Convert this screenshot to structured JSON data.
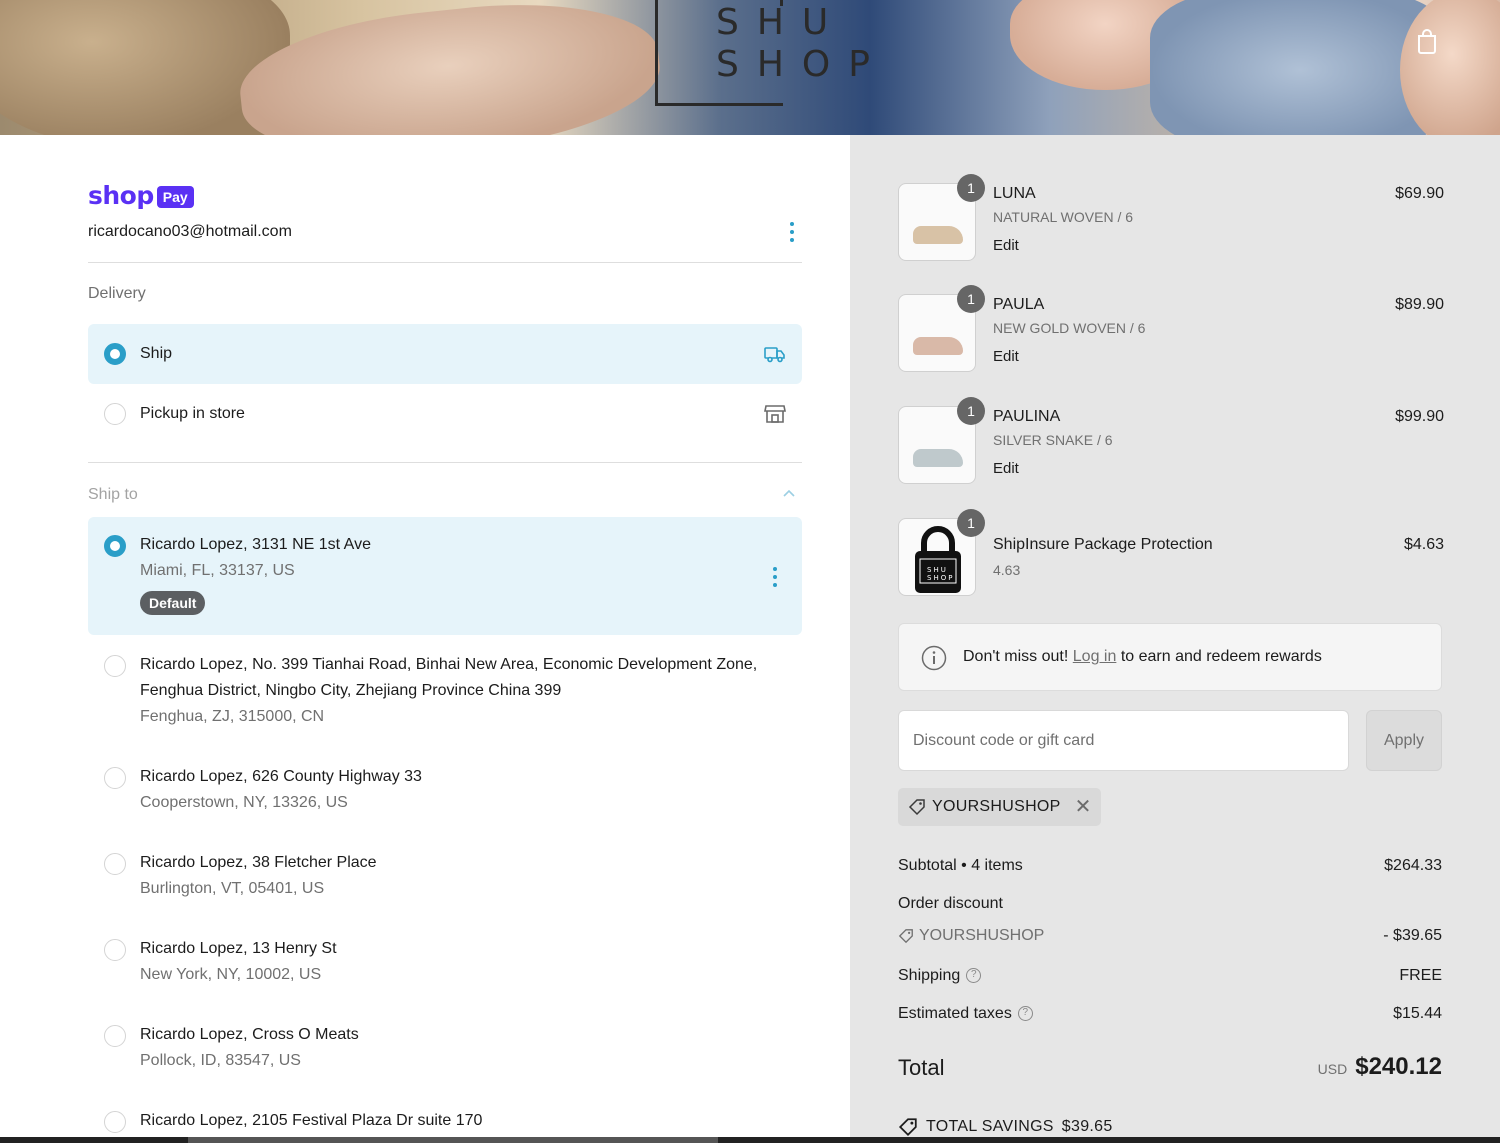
{
  "header": {
    "logo_line1": "SHU",
    "logo_line2": "SHOP",
    "cart_icon": "shopping-bag-icon"
  },
  "account": {
    "shop_word": "shop",
    "pay_badge": "Pay",
    "email": "ricardocano03@hotmail.com",
    "menu_icon": "kebab-menu-icon"
  },
  "delivery": {
    "label": "Delivery",
    "options": [
      {
        "label": "Ship",
        "selected": true,
        "icon": "truck-icon"
      },
      {
        "label": "Pickup in store",
        "selected": false,
        "icon": "store-icon"
      }
    ]
  },
  "ship_to": {
    "label": "Ship to",
    "addresses": [
      {
        "line1": "Ricardo Lopez, 3131 NE 1st Ave",
        "line2": "Miami, FL, 33137, US",
        "badge": "Default",
        "selected": true
      },
      {
        "line1": "Ricardo Lopez, No. 399 Tianhai Road, Binhai New Area, Economic Development Zone, Fenghua District, Ningbo City, Zhejiang Province China 399",
        "line2": "Fenghua, ZJ, 315000, CN",
        "selected": false
      },
      {
        "line1": "Ricardo Lopez, 626 County Highway 33",
        "line2": "Cooperstown, NY, 13326, US",
        "selected": false
      },
      {
        "line1": "Ricardo Lopez, 38 Fletcher Place",
        "line2": "Burlington, VT, 05401, US",
        "selected": false
      },
      {
        "line1": "Ricardo Lopez, 13 Henry St",
        "line2": "New York, NY, 10002, US",
        "selected": false
      },
      {
        "line1": "Ricardo Lopez, Cross O Meats",
        "line2": "Pollock, ID, 83547, US",
        "selected": false
      },
      {
        "line1": "Ricardo Lopez, 2105 Festival Plaza Dr suite 170",
        "line2": "",
        "selected": false
      }
    ]
  },
  "cart": {
    "items": [
      {
        "qty": "1",
        "name": "LUNA",
        "variant": "NATURAL WOVEN / 6",
        "edit": "Edit",
        "price": "$69.90",
        "swatch": "#d8c2a6"
      },
      {
        "qty": "1",
        "name": "PAULA",
        "variant": "NEW GOLD WOVEN / 6",
        "edit": "Edit",
        "price": "$89.90",
        "swatch": "#d9b9a8"
      },
      {
        "qty": "1",
        "name": "PAULINA",
        "variant": "SILVER SNAKE / 6",
        "edit": "Edit",
        "price": "$99.90",
        "swatch": "#bfc9cc"
      },
      {
        "qty": "1",
        "name": "ShipInsure Package Protection",
        "variant": "4.63",
        "edit": "",
        "price": "$4.63",
        "swatch": "#111111"
      }
    ],
    "insure_logo_line1": "SHU",
    "insure_logo_line2": "SHOP"
  },
  "rewards": {
    "prefix": "Don't miss out!",
    "link": "Log in",
    "suffix": "to earn and redeem rewards"
  },
  "discount": {
    "placeholder": "Discount code or gift card",
    "apply_label": "Apply",
    "applied_code": "YOURSHUSHOP"
  },
  "summary": {
    "subtotal_label": "Subtotal • 4 items",
    "subtotal_value": "$264.33",
    "order_discount_label": "Order discount",
    "discount_code": "YOURSHUSHOP",
    "discount_value": "- $39.65",
    "shipping_label": "Shipping",
    "shipping_value": "FREE",
    "taxes_label": "Estimated taxes",
    "taxes_value": "$15.44",
    "total_label": "Total",
    "currency": "USD",
    "total_value": "$240.12",
    "savings_label": "TOTAL SAVINGS",
    "savings_value": "$39.65"
  },
  "colors": {
    "accent": "#2a9ec8",
    "shop_pay": "#5a31f4",
    "selected_bg": "#e6f4fa",
    "summary_bg": "#e6e6e6"
  }
}
